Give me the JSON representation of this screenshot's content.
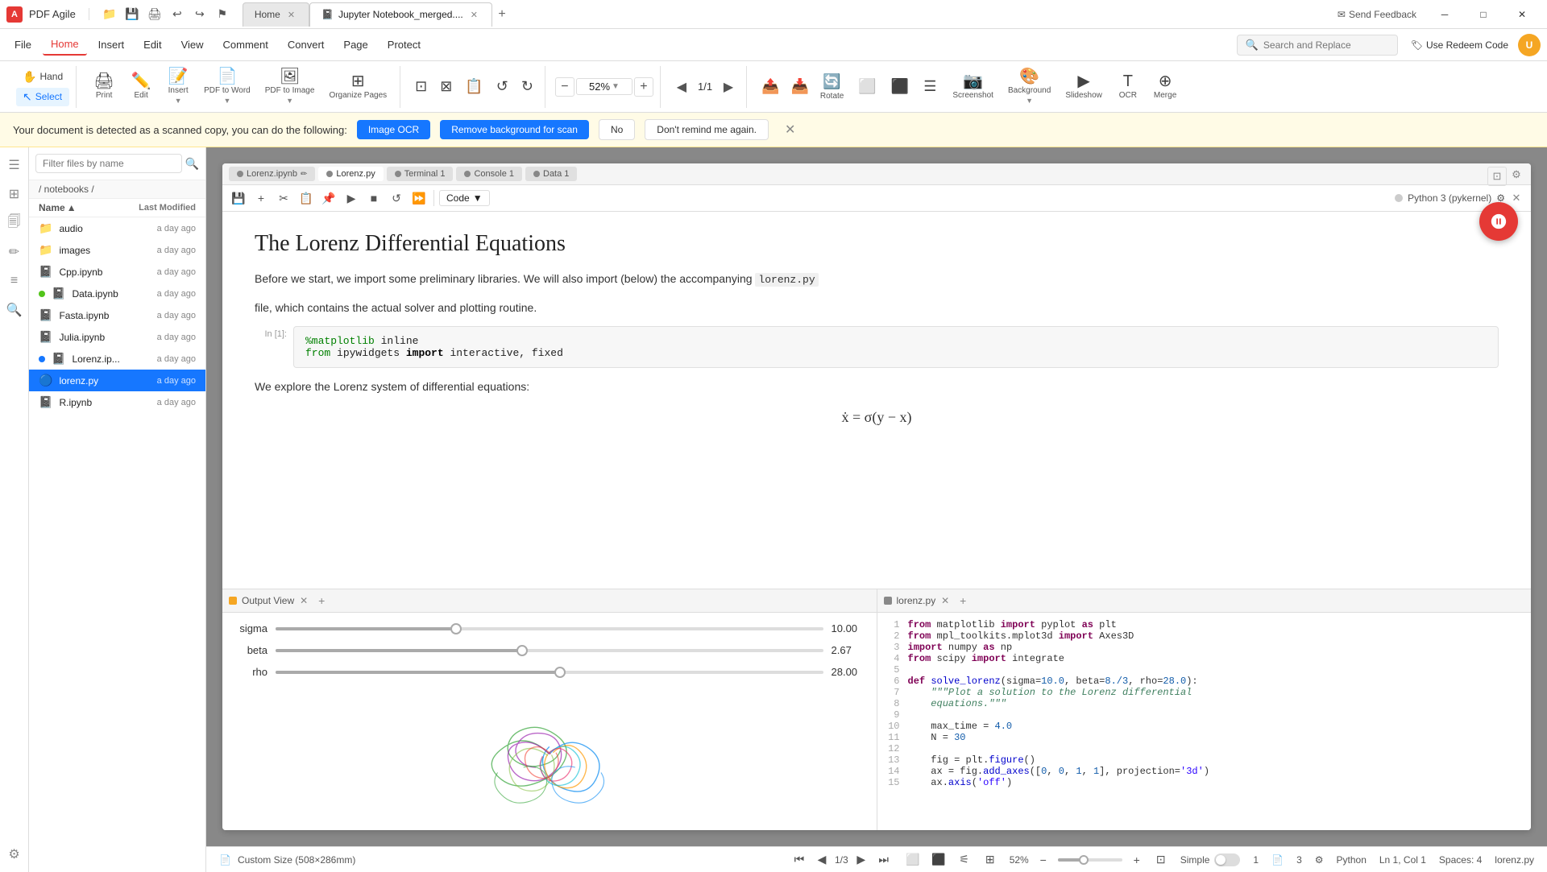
{
  "app": {
    "name": "PDF Agile",
    "logo": "A"
  },
  "titlebar": {
    "icons": [
      "folder-open",
      "save",
      "print",
      "undo",
      "redo",
      "flag"
    ],
    "tabs": [
      {
        "id": "home",
        "label": "Home",
        "active": false
      },
      {
        "id": "jupyter",
        "label": "Jupyter Notebook_merged....",
        "active": true
      }
    ],
    "add_tab": "+",
    "send_feedback": "Send Feedback",
    "controls": [
      "minimize",
      "maximize",
      "close"
    ]
  },
  "menubar": {
    "items": [
      {
        "id": "file",
        "label": "File",
        "active": false
      },
      {
        "id": "home",
        "label": "Home",
        "active": true
      },
      {
        "id": "insert",
        "label": "Insert",
        "active": false
      },
      {
        "id": "edit",
        "label": "Edit",
        "active": false
      },
      {
        "id": "view",
        "label": "View",
        "active": false
      },
      {
        "id": "comment",
        "label": "Comment",
        "active": false
      },
      {
        "id": "convert",
        "label": "Convert",
        "active": false
      },
      {
        "id": "page",
        "label": "Page",
        "active": false
      },
      {
        "id": "protect",
        "label": "Protect",
        "active": false
      }
    ],
    "search": {
      "placeholder": "Search and Replace"
    },
    "use_redeem": "Use Redeem Code"
  },
  "toolbar": {
    "hand_label": "Hand",
    "select_label": "Select",
    "print_label": "Print",
    "edit_label": "Edit",
    "insert_label": "Insert",
    "pdf_to_word_label": "PDF to Word",
    "pdf_to_image_label": "PDF to Image",
    "organize_pages_label": "Organize Pages",
    "zoom_level": "52%",
    "page_current": "1",
    "page_total": "1",
    "rotate_label": "Rotate",
    "screenshot_label": "Screenshot",
    "background_label": "Background",
    "slideshow_label": "Slideshow",
    "ocr_label": "OCR",
    "merge_label": "Merge"
  },
  "notification": {
    "text": "Your document is detected as a scanned copy, you can do the following:",
    "btn_ocr": "Image OCR",
    "btn_remove_bg": "Remove background for scan",
    "btn_no": "No",
    "btn_dont_remind": "Don't remind me again."
  },
  "file_panel": {
    "filter_placeholder": "Filter files by name",
    "path": "/ notebooks /",
    "col_name": "Name",
    "col_modified": "Last Modified",
    "files": [
      {
        "name": "audio",
        "type": "folder",
        "modified": "a day ago",
        "dot": false
      },
      {
        "name": "images",
        "type": "folder",
        "modified": "a day ago",
        "dot": false
      },
      {
        "name": "Cpp.ipynb",
        "type": "notebook",
        "modified": "a day ago",
        "dot": false
      },
      {
        "name": "Data.ipynb",
        "type": "notebook",
        "modified": "a day ago",
        "dot": "green"
      },
      {
        "name": "Fasta.ipynb",
        "type": "notebook",
        "modified": "a day ago",
        "dot": false
      },
      {
        "name": "Julia.ipynb",
        "type": "notebook",
        "modified": "a day ago",
        "dot": false
      },
      {
        "name": "Lorenz.ip...",
        "type": "notebook",
        "modified": "a day ago",
        "dot": "blue"
      },
      {
        "name": "lorenz.py",
        "type": "py",
        "modified": "a day ago",
        "active": true
      },
      {
        "name": "R.ipynb",
        "type": "notebook",
        "modified": "a day ago",
        "dot": false
      }
    ]
  },
  "jupyter": {
    "tabs": [
      {
        "label": "Lorenz.ipynb",
        "active": false
      },
      {
        "label": "Lorenz.py",
        "active": false
      },
      {
        "label": "Terminal 1",
        "active": false
      },
      {
        "label": "Console 1",
        "active": false
      },
      {
        "label": "Data 1",
        "active": false
      }
    ],
    "code_dropdown": "Code",
    "kernel": "Python 3 (pykernel)",
    "title": "The Lorenz Differential Equations",
    "intro": "Before we start, we import some preliminary libraries. We will also import (below) the accompanying",
    "code_inline": "lorenz.py",
    "intro2": "file, which contains the actual solver and plotting routine.",
    "cell_num": "In [1]:",
    "cell_code_line1": "%matplotlib inline",
    "cell_code_line2": "from ipywidgets import interactive, fixed",
    "explore_text": "We explore the Lorenz system of differential equations:",
    "math": "ẋ = σ(y − x)"
  },
  "output_panel": {
    "title": "Output View",
    "sliders": [
      {
        "label": "sigma",
        "value": 10.0,
        "percent": 33
      },
      {
        "label": "beta",
        "value": 2.67,
        "percent": 45
      },
      {
        "label": "rho",
        "value": 28.0,
        "percent": 52
      }
    ]
  },
  "lorenz_panel": {
    "title": "lorenz.py",
    "code_lines": [
      {
        "num": 1,
        "code": "from matplotlib import pyplot as plt"
      },
      {
        "num": 2,
        "code": "from mpl_toolkits.mplot3d import Axes3D"
      },
      {
        "num": 3,
        "code": "import numpy as np"
      },
      {
        "num": 4,
        "code": "from scipy import integrate"
      },
      {
        "num": 5,
        "code": ""
      },
      {
        "num": 6,
        "code": "def solve_lorenz(sigma=10.0, beta=8./3, rho=28.0):"
      },
      {
        "num": 7,
        "code": "    \"\"\"Plot a solution to the Lorenz differential"
      },
      {
        "num": 8,
        "code": "    equations.\"\"\""
      },
      {
        "num": 9,
        "code": ""
      },
      {
        "num": 10,
        "code": "    max_time = 4.0"
      },
      {
        "num": 11,
        "code": "    N = 30"
      },
      {
        "num": 12,
        "code": ""
      },
      {
        "num": 13,
        "code": "    fig = plt.figure()"
      },
      {
        "num": 14,
        "code": "    ax = fig.add_axes([0, 0, 1, 1], projection='3d')"
      },
      {
        "num": 15,
        "code": "    ax.axis('off')"
      }
    ]
  },
  "status_bar": {
    "page_size": "Custom Size (508×286mm)",
    "mode": "Simple",
    "page_current": "1",
    "page_total": "3",
    "language": "Python",
    "zoom": "52%",
    "ln": "Ln 1",
    "col": "Col 1",
    "spaces": "Spaces: 4",
    "file": "lorenz.py"
  },
  "colors": {
    "accent": "#e53935",
    "primary": "#1677ff",
    "active_bg": "#1677ff",
    "active_text": "#ffffff"
  }
}
